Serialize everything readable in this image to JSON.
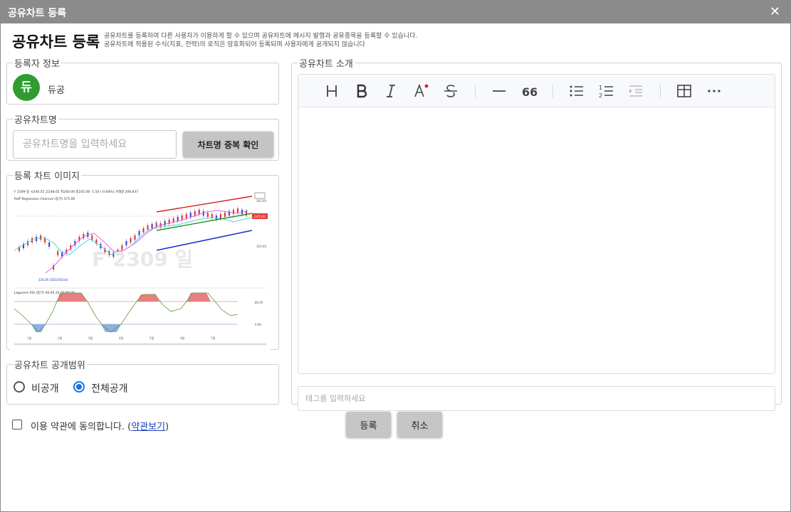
{
  "dialog": {
    "title": "공유차트 등록",
    "close_icon": "close-icon",
    "heading": "공유차트 등록",
    "desc_line1": "공유차트를 등록하여 다른 사용자가 이용하게 할 수 있으며 공유차트에 메시지 발행과 공유종목을 등록할 수 있습니다.",
    "desc_line2": "공유차트에 적용된 수식(지표, 전략)의 로직은 암호화되어 등록되며 사용자에게 공개되지 않습니다"
  },
  "registrant": {
    "legend": "등록자 정보",
    "avatar_text": "듀",
    "avatar_color": "#2e9d2e",
    "name": "듀공"
  },
  "chart_name": {
    "legend": "공유차트명",
    "placeholder": "공유차트명을 입력하세요",
    "value": "",
    "check_button": "차트명 중복 확인"
  },
  "chart_image": {
    "legend": "등록 차트 이미지",
    "symbol_line": "F 2309 일  시240.55 고248.65 저240.00 종245.00 -1.50 (-0.60%) 거래량 209,837",
    "indicator_line": "Raff Regression Channel  (종가)  375.00",
    "watermark": "F 2309 일",
    "price_labels": [
      "365.00",
      "245.00",
      "320.00"
    ],
    "low_label": "230.36 (2023/03/14)",
    "rsi_label": "Laguerre RSI  (종가)  49.00  20.00  80.00",
    "rsi_axis": [
      "80.00",
      "0.00"
    ],
    "x_ticks": [
      "1월",
      "2월",
      "3월",
      "4월",
      "5월",
      "6월",
      "7월"
    ]
  },
  "visibility": {
    "legend": "공유차트 공개범위",
    "options": [
      {
        "label": "비공개",
        "selected": false
      },
      {
        "label": "전체공개",
        "selected": true
      }
    ]
  },
  "agreement": {
    "text": "이용 약관에 동의합니다. (",
    "link": "약관보기",
    "suffix": ")",
    "checked": false
  },
  "intro": {
    "legend": "공유차트 소개",
    "toolbar": [
      "heading-icon",
      "bold-icon",
      "italic-icon",
      "text-color-icon",
      "strikethrough-icon",
      "horizontal-rule-icon",
      "quote-icon",
      "bullet-list-icon",
      "ordered-list-icon",
      "outdent-icon",
      "table-icon",
      "more-icon"
    ],
    "body": "",
    "tag_placeholder": "태그를 입력하세요"
  },
  "actions": {
    "register": "등록",
    "cancel": "취소"
  }
}
